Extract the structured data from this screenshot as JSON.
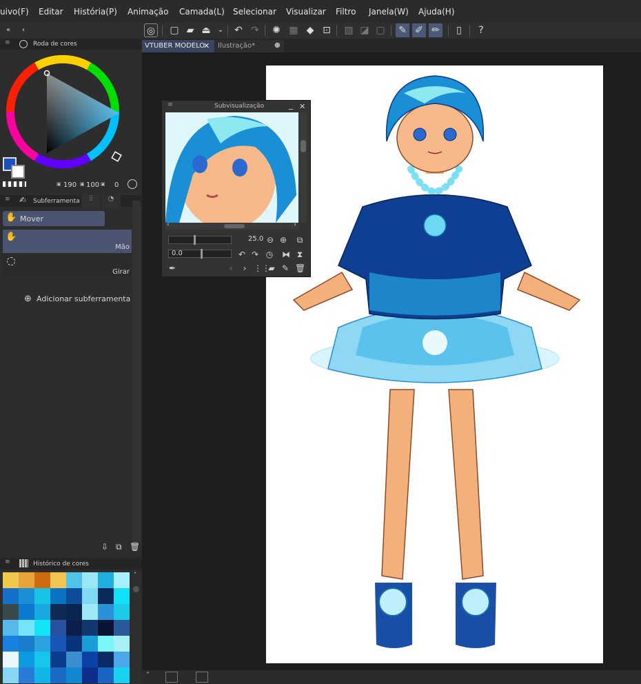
{
  "menu": {
    "items": [
      "uivo(F)",
      "Editar",
      "História(P)",
      "Animação",
      "Camada(L)",
      "Selecionar",
      "Visualizar",
      "Filtro",
      "Janela(W)",
      "Ajuda(H)"
    ]
  },
  "color_wheel_panel": {
    "title": "Roda de cores",
    "value_1": "190",
    "value_2": "100",
    "value_3": "0",
    "main_color": "#1a4fbf",
    "sub_color": "#ffffff"
  },
  "subtool_panel": {
    "title": "Subferramenta",
    "group_label": "Mover",
    "items": [
      {
        "label": "Mão"
      },
      {
        "label": "Girar"
      }
    ],
    "add_label": "Adicionar subferramenta"
  },
  "color_history_panel": {
    "title": "Histórico de cores",
    "swatches": [
      "#f0c94a",
      "#e8a23a",
      "#d06a10",
      "#f2c552",
      "#4fc3e8",
      "#9be6f4",
      "#1fb0e0",
      "#a6f0ff",
      "#1470c8",
      "#1b8fd6",
      "#18c4e6",
      "#0a74c4",
      "#0f4c9a",
      "#7fd9f0",
      "#0a2a5c",
      "#10e0f8",
      "#3a4a4a",
      "#0c78d0",
      "#1aa8e0",
      "#0f2a55",
      "#082650",
      "#9ee8f8",
      "#2a92d8",
      "#1ccbe8",
      "#56b8ec",
      "#76e4f8",
      "#12e6f6",
      "#2a50a0",
      "#0c1e4a",
      "#12386e",
      "#0a1434",
      "#2a5a9a",
      "#1880e0",
      "#1a7ccc",
      "#2aa2e0",
      "#1a56b8",
      "#0a3478",
      "#1a9ed8",
      "#7af6f8",
      "#a8f0f4",
      "#eaf8fc",
      "#0c9ae0",
      "#14c6ea",
      "#0a3c8c",
      "#3a8fd0",
      "#0a42a8",
      "#0c2a66",
      "#4aa8e8",
      "#86d6f4",
      "#2a7ad8",
      "#12b6e6",
      "#1a6ac6",
      "#1088d0",
      "#0c2e8a",
      "#1a64c2",
      "#18d2f0"
    ]
  },
  "toolbar": {
    "icons": [
      "app-icon",
      "new-icon",
      "open-icon",
      "save-icon",
      "dropdown-icon",
      "undo-icon",
      "redo-icon",
      "loading-icon",
      "transform-icon",
      "fill-icon",
      "crop-icon",
      "grid-icon",
      "ruler-icon",
      "frame-icon",
      "pen-icon",
      "brush-icon",
      "eraser-icon",
      "device-icon",
      "help-icon"
    ]
  },
  "doc_tabs": {
    "tab1": "VTUBER MODELO",
    "tab2": "Ilustração*"
  },
  "subview": {
    "title": "Subvisualização",
    "zoom_value": "25.0",
    "rotation_value": "0.0"
  },
  "colors": {
    "accent": "#4a5a78",
    "panel_bg": "#2d2d2d",
    "canvas_bg": "#1e1e1e",
    "paper": "#ffffff"
  }
}
